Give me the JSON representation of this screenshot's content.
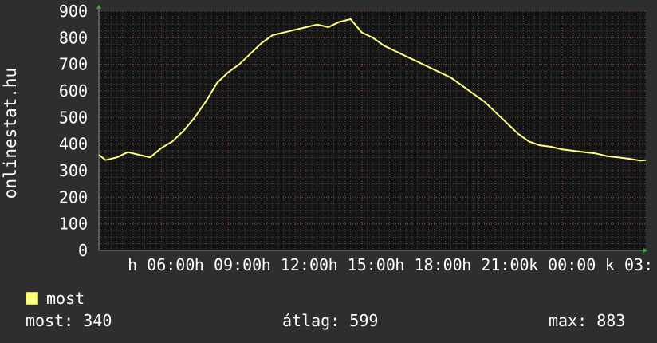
{
  "chart_data": {
    "type": "line",
    "ylabel": "onlinestat.hu",
    "ylim": [
      0,
      900
    ],
    "yticks": [
      0,
      100,
      200,
      300,
      400,
      500,
      600,
      700,
      800,
      900
    ],
    "xticks": [
      "h 06:00",
      "h 09:00",
      "h 12:00",
      "h 15:00",
      "h 18:00",
      "h 21:00",
      "k 00:00",
      "k 03:"
    ],
    "xtick_pos": [
      1.5,
      4.5,
      7.5,
      10.5,
      13.5,
      16.5,
      19.5,
      22.5
    ],
    "xlim": [
      -1.3,
      23.25
    ],
    "grid": true,
    "series": [
      {
        "name": "most",
        "color": "#ffff80",
        "x": [
          -1.3,
          -1,
          -0.5,
          0,
          0.5,
          1,
          1.5,
          2,
          2.5,
          3,
          3.5,
          4,
          4.5,
          5,
          5.5,
          6,
          6.5,
          7,
          7.5,
          8,
          8.5,
          9,
          9.5,
          10,
          10.5,
          11,
          11.5,
          12,
          12.5,
          13,
          13.5,
          14,
          14.5,
          15,
          15.5,
          16,
          16.5,
          17,
          17.5,
          18,
          18.5,
          19,
          19.5,
          20,
          20.5,
          21,
          21.5,
          22,
          22.5,
          23,
          23.25
        ],
        "y": [
          360,
          340,
          350,
          370,
          360,
          350,
          385,
          410,
          450,
          500,
          560,
          630,
          670,
          700,
          740,
          780,
          810,
          820,
          830,
          840,
          850,
          840,
          860,
          870,
          820,
          800,
          770,
          750,
          730,
          710,
          690,
          670,
          650,
          620,
          590,
          560,
          520,
          480,
          440,
          410,
          395,
          390,
          380,
          375,
          370,
          365,
          355,
          350,
          345,
          338,
          340
        ]
      }
    ]
  },
  "legend": {
    "label": "most",
    "color": "#ffff80"
  },
  "stats": {
    "current": "most: 340",
    "average": "átlag: 599",
    "max": "max: 883"
  }
}
